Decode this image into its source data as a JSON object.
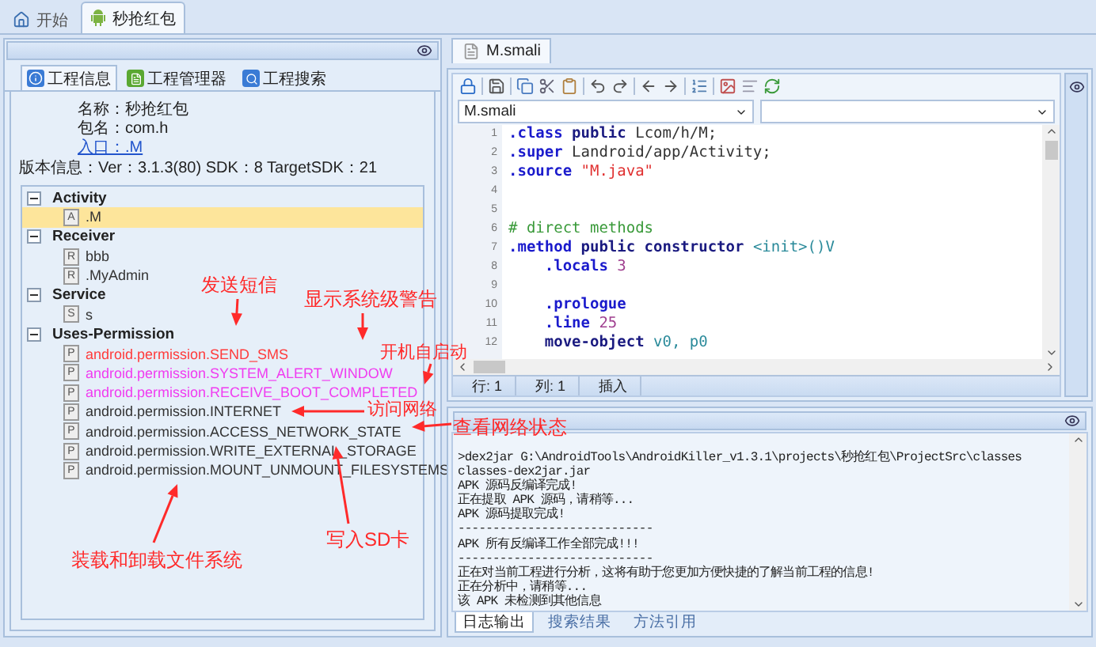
{
  "top_tabs": [
    {
      "label": "开始",
      "selected": false
    },
    {
      "label": "秒抢红包",
      "selected": true
    }
  ],
  "left_panel": {
    "tabs": [
      {
        "label": "工程信息",
        "selected": true
      },
      {
        "label": "工程管理器",
        "selected": false
      },
      {
        "label": "工程搜索",
        "selected": false
      }
    ],
    "info": {
      "name": "名称：秒抢红包",
      "package": "包名：com.h",
      "entry": "入口：.M",
      "version": "版本信息：Ver：3.1.3(80) SDK：8 TargetSDK：21"
    },
    "tree": [
      {
        "label": "Activity",
        "expanded": true,
        "children": [
          {
            "label": ".M",
            "badge": "A",
            "selected": true
          }
        ]
      },
      {
        "label": "Receiver",
        "expanded": true,
        "children": [
          {
            "label": "bbb",
            "badge": "R",
            "selected": false
          },
          {
            "label": ".MyAdmin",
            "badge": "R",
            "selected": false
          }
        ]
      },
      {
        "label": "Service",
        "expanded": true,
        "children": [
          {
            "label": "s",
            "badge": "S",
            "selected": false
          }
        ]
      },
      {
        "label": "Uses-Permission",
        "expanded": true,
        "children": [
          {
            "label": "android.permission.SEND_SMS",
            "badge": "P",
            "selected": false,
            "color": "#ff3b3b"
          },
          {
            "label": "android.permission.SYSTEM_ALERT_WINDOW",
            "badge": "P",
            "selected": false,
            "color": "#f03cf0"
          },
          {
            "label": "android.permission.RECEIVE_BOOT_COMPLETED",
            "badge": "P",
            "selected": false,
            "color": "#f03cf0"
          },
          {
            "label": "android.permission.INTERNET",
            "badge": "P",
            "selected": false,
            "color": "#333333"
          },
          {
            "label": "android.permission.ACCESS_NETWORK_STATE",
            "badge": "P",
            "selected": false,
            "color": "#333333"
          },
          {
            "label": "android.permission.WRITE_EXTERNAL_STORAGE",
            "badge": "P",
            "selected": false,
            "color": "#333333"
          },
          {
            "label": "android.permission.MOUNT_UNMOUNT_FILESYSTEMS",
            "badge": "P",
            "selected": false,
            "color": "#333333"
          }
        ]
      }
    ]
  },
  "editor": {
    "tabs": [
      {
        "label": "M.smali",
        "selected": true
      }
    ],
    "file_select": "M.smali",
    "lines": [
      {
        "number": "1",
        "tokens": [
          {
            "kind": "directive",
            "text": ".class"
          },
          {
            "kind": "keyword",
            "text": " public"
          },
          {
            "kind": "plain",
            "text": " Lcom/h/M;"
          }
        ]
      },
      {
        "number": "2",
        "tokens": [
          {
            "kind": "directive",
            "text": ".super"
          },
          {
            "kind": "plain",
            "text": " Landroid/app/Activity;"
          }
        ]
      },
      {
        "number": "3",
        "tokens": [
          {
            "kind": "directive",
            "text": ".source"
          },
          {
            "kind": "string",
            "text": " \"M.java\""
          }
        ]
      },
      {
        "number": "4"
      },
      {
        "number": "5"
      },
      {
        "number": "6",
        "tokens": [
          {
            "kind": "comment",
            "text": "# direct methods"
          }
        ]
      },
      {
        "number": "7",
        "tokens": [
          {
            "kind": "directive",
            "text": ".method"
          },
          {
            "kind": "keyword",
            "text": " public constructor"
          },
          {
            "kind": "type",
            "text": " <init>()V"
          }
        ]
      },
      {
        "number": "8",
        "tokens": [
          {
            "kind": "directive",
            "text": "    .locals"
          },
          {
            "kind": "number",
            "text": " 3"
          }
        ]
      },
      {
        "number": "9"
      },
      {
        "number": "10",
        "tokens": [
          {
            "kind": "directive",
            "text": "    .prologue"
          }
        ]
      },
      {
        "number": "11",
        "tokens": [
          {
            "kind": "directive",
            "text": "    .line"
          },
          {
            "kind": "number",
            "text": " 25"
          }
        ]
      },
      {
        "number": "12",
        "tokens": [
          {
            "kind": "keyword",
            "text": "    move-object"
          },
          {
            "kind": "type",
            "text": " v0, p0"
          }
        ]
      }
    ],
    "status": [
      "行: 1",
      "列: 1",
      "插入"
    ]
  },
  "log": {
    "lines": [
      ">dex2jar G:\\AndroidTools\\AndroidKiller_v1.3.1\\projects\\秒抢红包\\ProjectSrc\\classes",
      "classes-dex2jar.jar",
      "APK 源码反编译完成!",
      "正在提取 APK 源码，请稍等...",
      "APK 源码提取完成!",
      "----------------------------",
      "APK 所有反编译工作全部完成!!!",
      "----------------------------",
      "正在对当前工程进行分析，这将有助于您更加方便快捷的了解当前工程的信息!",
      "正在分析中，请稍等...",
      "该 APK 未检测到其他信息"
    ],
    "tabs": [
      {
        "label": "日志输出",
        "selected": true
      },
      {
        "label": "搜索结果",
        "selected": false
      },
      {
        "label": "方法引用",
        "selected": false
      }
    ]
  },
  "annotations": [
    {
      "text": "发送短信"
    },
    {
      "text": "显示系统级警告"
    },
    {
      "text": "开机自启动"
    },
    {
      "text": "访问网络"
    },
    {
      "text": "查看网络状态"
    },
    {
      "text": "写入SD卡"
    },
    {
      "text": "装载和卸载文件系统"
    }
  ]
}
